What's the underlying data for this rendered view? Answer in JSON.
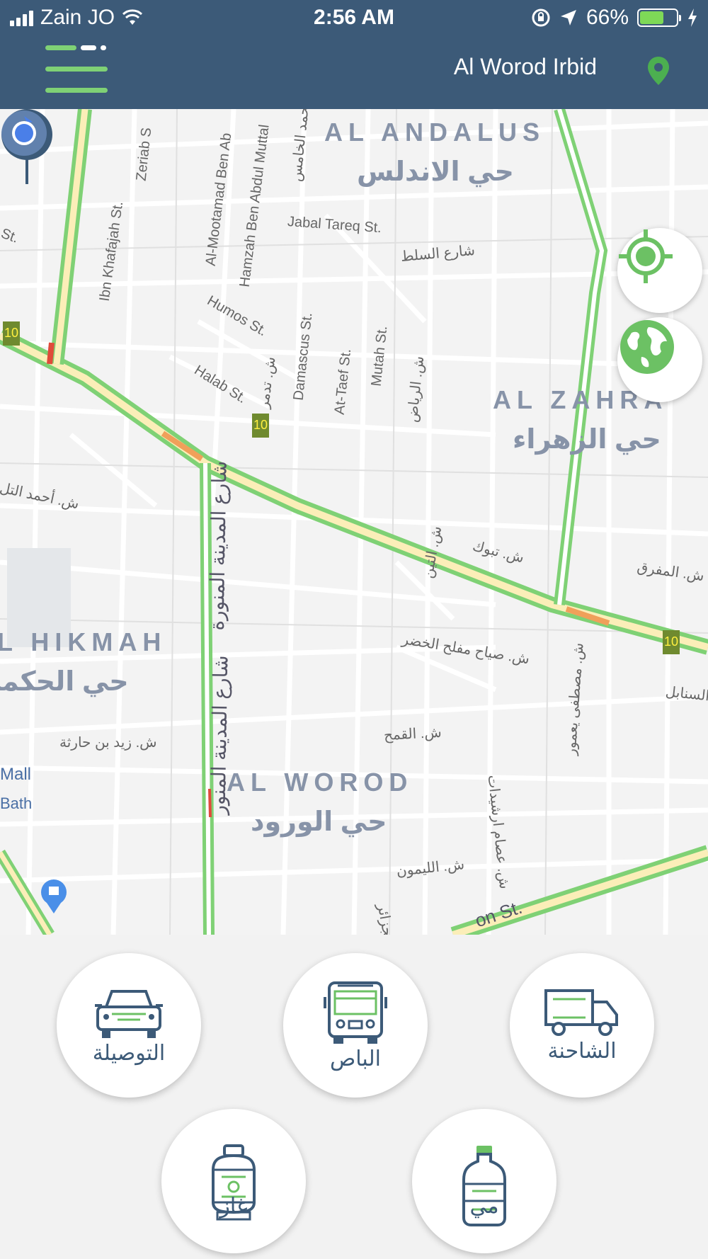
{
  "status_bar": {
    "carrier": "Zain JO",
    "time": "2:56 AM",
    "battery": "66%",
    "battery_level": 0.66
  },
  "header": {
    "location_name": "Al Worod Irbid",
    "menu_icon": "hamburger-menu-icon",
    "pin_icon": "map-pin-icon"
  },
  "map": {
    "districts": [
      {
        "en": "AL ANDALUS",
        "ar": "حي الاندلس"
      },
      {
        "en": "AL ZAHRA'",
        "ar": "حي الزهراء"
      },
      {
        "en": "L HIKMAH",
        "ar": "حي الحكمة"
      },
      {
        "en": "AL WOROD",
        "ar": "حي الورود"
      }
    ],
    "streets": [
      "Zeriab S",
      "Ibn Khafajah St.",
      "Al-Mootamad Ben Ab",
      "Hamzah Ben Abdul Muttal",
      "محمد الخامس",
      "Jabal Tareq St.",
      "شارع السلط",
      "St.",
      "Humos St.",
      "ش. تدمر",
      "Damascus St.",
      "At-Taef St.",
      "Mutah St.",
      "ش. الرياض",
      "Halab St.",
      "ش. أحمد التل",
      "شارع المدينة المنورة",
      "ش. تبوك",
      "ش. المفرق",
      "ش. التين",
      "ش. صياح مفلح الخضر",
      "السنابل",
      "ش. زيد بن حارثة",
      "ش. القمح",
      "ش. عصام ارشيدات",
      "ش. مصطفى يعمور",
      "ش. الليمون",
      "الجزائر",
      "شارع المدينة المنور",
      "Mall",
      "Bath",
      "on St."
    ],
    "route_shields": [
      "10",
      "10",
      "10"
    ],
    "buttons": {
      "locate_icon": "crosshair-locate-icon",
      "globe_icon": "globe-icon"
    }
  },
  "services": [
    {
      "label": "التوصيلة",
      "icon": "car-icon"
    },
    {
      "label": "الباص",
      "icon": "bus-icon"
    },
    {
      "label": "الشاحنة",
      "icon": "truck-icon"
    },
    {
      "label": "غاز",
      "icon": "gas-cylinder-icon"
    },
    {
      "label": "مي",
      "icon": "water-bottle-icon"
    }
  ],
  "colors": {
    "header_bg": "#3c5a78",
    "accent_green": "#6cc164",
    "icon_navy": "#3c5a78"
  }
}
